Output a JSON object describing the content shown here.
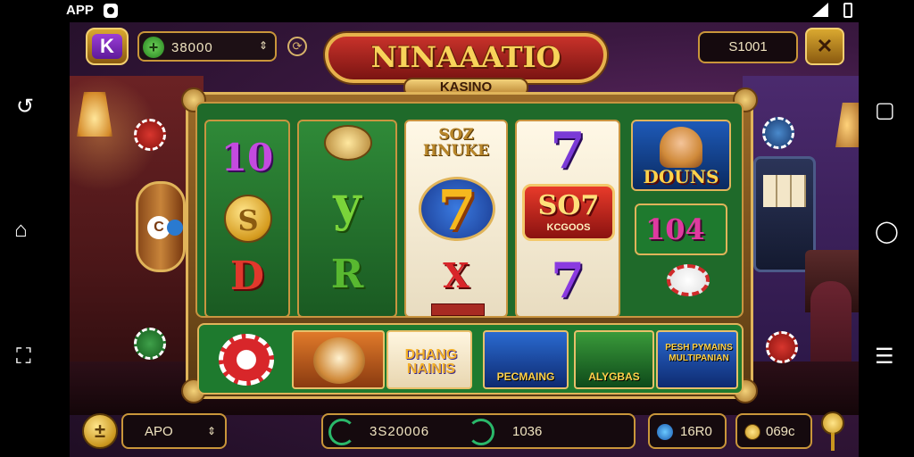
{
  "statusbar": {
    "app_label": "APP"
  },
  "nav": {
    "back": "↺",
    "home": "⌂",
    "recent": "⛶",
    "square": "▢",
    "circle": "◯",
    "menu": "☰"
  },
  "header": {
    "k_button": "K",
    "coins": "38000",
    "coins_plus": "+",
    "coins_dropdown": "⇕",
    "logo_title": "NINAAATIO",
    "logo_sub": "KASINO",
    "balance": "S1001",
    "close": "✕"
  },
  "reels": {
    "col0": [
      "10",
      "S",
      "D"
    ],
    "col1": [
      "",
      "y",
      "R"
    ],
    "col2_top": "SOZ HNUKE",
    "col2_mid": "7",
    "col2_bot": "X",
    "col3_top": "7",
    "col3_mid_big": "SO7",
    "col3_mid_small": "KCGOOS",
    "col3_bot": "7",
    "side_tile_top": "DOUNS",
    "side_tile_mid": "104"
  },
  "side_buttons": {
    "left_reel_toggle": "C"
  },
  "bottom_games": [
    {
      "label": ""
    },
    {
      "label": ""
    },
    {
      "label": "DHANG NAINIS"
    },
    {
      "label": "PECMAING"
    },
    {
      "label": "ALYGBAS"
    },
    {
      "label": "PESH PYMAINS MULTIPANIAN"
    }
  ],
  "bottom_hud": {
    "coin_icon_label": "±",
    "bet_label": "APO",
    "bet_dropdown": "⇕",
    "win_value": "3S20006",
    "win_side": "1036",
    "gems_value": "16R0",
    "gold_value": "069c"
  },
  "colors": {
    "gold": "#e0b45a",
    "felt_green": "#1f6a2a",
    "accent_red": "#c8322a"
  }
}
